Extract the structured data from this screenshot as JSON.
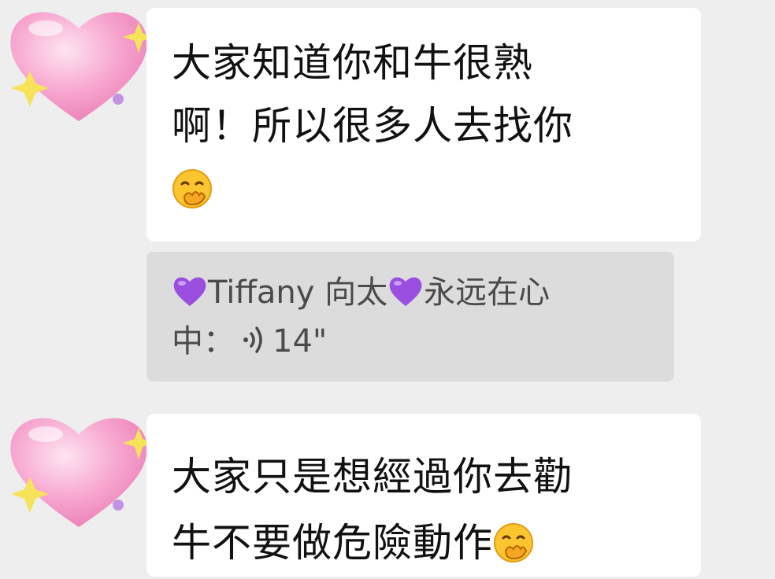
{
  "colors": {
    "background": "#eeeeee",
    "bubble": "#ffffff",
    "quote_bubble": "#dcdcdc",
    "heart_avatar": "#f7a6cf",
    "purple_heart": "#9b4fe0",
    "sparkle": "#f7e35a"
  },
  "messages": [
    {
      "avatar_icon": "pink-heart-sparkle-icon",
      "lines": [
        "大家知道你和牛很熟",
        "啊！所以很多人去找你"
      ],
      "emoji": "hand-over-mouth-emoji-icon"
    },
    {
      "avatar_icon": "pink-heart-sparkle-icon",
      "lines": [
        "大家只是想經過你去勸",
        "牛不要做危險動作"
      ],
      "emoji": "hand-over-mouth-emoji-icon"
    }
  ],
  "quote": {
    "name_part1": "Tiffany 向太",
    "name_part2": "永远在心",
    "line2_prefix": "中：",
    "voice_duration": "14\"",
    "icons": [
      "purple-heart-icon",
      "voice-wave-icon"
    ]
  }
}
